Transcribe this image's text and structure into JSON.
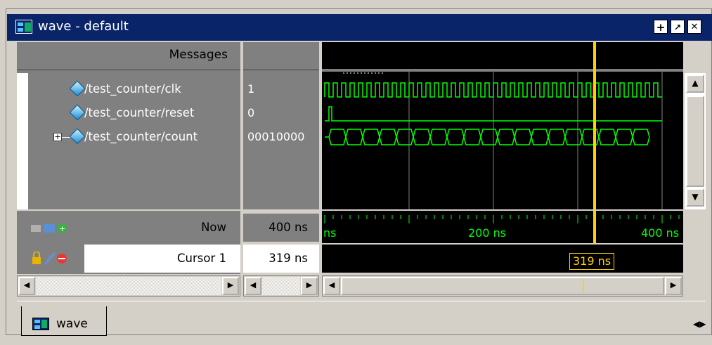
{
  "window": {
    "title": "wave - default",
    "title_buttons": [
      "+",
      "↗",
      "✕"
    ]
  },
  "names": {
    "header": "Messages",
    "signals": [
      {
        "name": "/test_counter/clk",
        "value": "1",
        "expandable": false
      },
      {
        "name": "/test_counter/reset",
        "value": "0",
        "expandable": false
      },
      {
        "name": "/test_counter/count",
        "value": "00010000",
        "expandable": true
      }
    ]
  },
  "status": {
    "now_label": "Now",
    "now_value": "400 ns",
    "cursor_label": "Cursor 1",
    "cursor_value": "319 ns"
  },
  "ruler": {
    "labels": [
      "ns",
      "200 ns",
      "400 ns"
    ],
    "cursor_time": "319 ns"
  },
  "tab": {
    "label": "wave"
  },
  "colors": {
    "title_bg": "#0a246a",
    "wave_green": "#00ff00",
    "cursor_yellow": "#ffd200",
    "cursor_red": "#ff0000",
    "pane_gray": "#808080"
  },
  "icons": [
    "wave-window-icon",
    "dock-icon",
    "undock-icon",
    "close-icon",
    "signal-diamond-icon",
    "lock-icon",
    "wrench-icon",
    "remove-icon",
    "add-icon",
    "new-window-icon"
  ]
}
